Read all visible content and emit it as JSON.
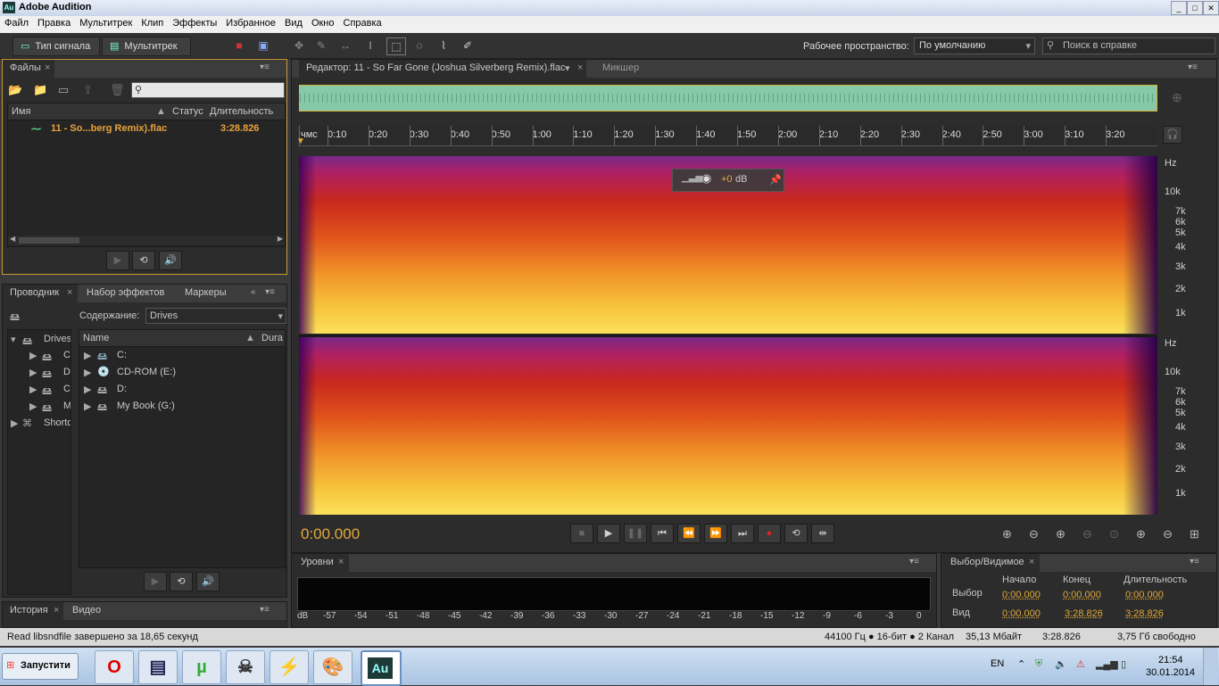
{
  "app": {
    "title": "Adobe Audition",
    "logo": "Au"
  },
  "menu": [
    "Файл",
    "Правка",
    "Мультитрек",
    "Клип",
    "Эффекты",
    "Избранное",
    "Вид",
    "Окно",
    "Справка"
  ],
  "toolbar": {
    "waveform_label": "Тип сигнала",
    "multitrack_label": "Мультитрек",
    "workspace_label": "Рабочее пространство:",
    "workspace_value": "По умолчанию",
    "search_placeholder": "Поиск в справке"
  },
  "files_panel": {
    "tab": "Файлы",
    "columns": [
      "Имя",
      "Статус",
      "Длительность"
    ],
    "file": {
      "name": "11 - So...berg Remix).flac",
      "duration": "3:28.826"
    }
  },
  "explorer_panel": {
    "tabs": [
      "Проводник",
      "Набор эффектов",
      "Маркеры"
    ],
    "content_label": "Содержание:",
    "content_value": "Drives",
    "tree": [
      "Drives",
      "C",
      "D",
      "C",
      "M",
      "Shortc"
    ],
    "columns": [
      "Name",
      "Dura"
    ],
    "items": [
      "C:",
      "CD-ROM (E:)",
      "D:",
      "My Book (G:)"
    ]
  },
  "history_panel": {
    "tabs": [
      "История",
      "Видео"
    ]
  },
  "editor": {
    "tab": "Редактор: 11 - So Far Gone (Joshua Silverberg Remix).flac",
    "mixer_tab": "Микшер",
    "ruler": [
      "чмс",
      "0:10",
      "0:20",
      "0:30",
      "0:40",
      "0:50",
      "1:00",
      "1:10",
      "1:20",
      "1:30",
      "1:40",
      "1:50",
      "2:00",
      "2:10",
      "2:20",
      "2:30",
      "2:40",
      "2:50",
      "3:00",
      "3:10",
      "3:20"
    ],
    "hz_labels": [
      "Hz",
      "10k",
      "7k",
      "6k",
      "5k",
      "4k",
      "3k",
      "2k",
      "1k"
    ],
    "hud_gain": "+0",
    "hud_unit": "dB",
    "time": "0:00.000"
  },
  "levels_panel": {
    "tab": "Уровни",
    "scale": [
      "dB",
      "-57",
      "-54",
      "-51",
      "-48",
      "-45",
      "-42",
      "-39",
      "-36",
      "-33",
      "-30",
      "-27",
      "-24",
      "-21",
      "-18",
      "-15",
      "-12",
      "-9",
      "-6",
      "-3",
      "0"
    ]
  },
  "selection_panel": {
    "tab": "Выбор/Видимое",
    "headers": [
      "Начало",
      "Конец",
      "Длительность"
    ],
    "rows": [
      {
        "label": "Выбор",
        "start": "0:00.000",
        "end": "0:00.000",
        "duration": "0:00.000"
      },
      {
        "label": "Вид",
        "start": "0:00.000",
        "end": "3:28.826",
        "duration": "3:28.826"
      }
    ]
  },
  "status_bar": {
    "message": "Read libsndfile завершено за 18,65 секунд",
    "format": "44100 Гц ● 16-бит ● 2 Канал",
    "size": "35,13 Мбайт",
    "duration": "3:28.826",
    "free": "3,75 Гб свободно"
  },
  "taskbar": {
    "start": "Запустити",
    "lang": "EN",
    "time": "21:54",
    "date": "30.01.2014",
    "apps": [
      "opera-icon",
      "save-icon",
      "utorrent-icon",
      "alien-icon",
      "lightning-icon",
      "paint-icon",
      "audition-icon"
    ],
    "active_app_label": "Au"
  },
  "colors": {
    "accent": "#e8a33c",
    "waveform_green": "#86c9a8",
    "selection_yellow": "#d8b23a"
  }
}
